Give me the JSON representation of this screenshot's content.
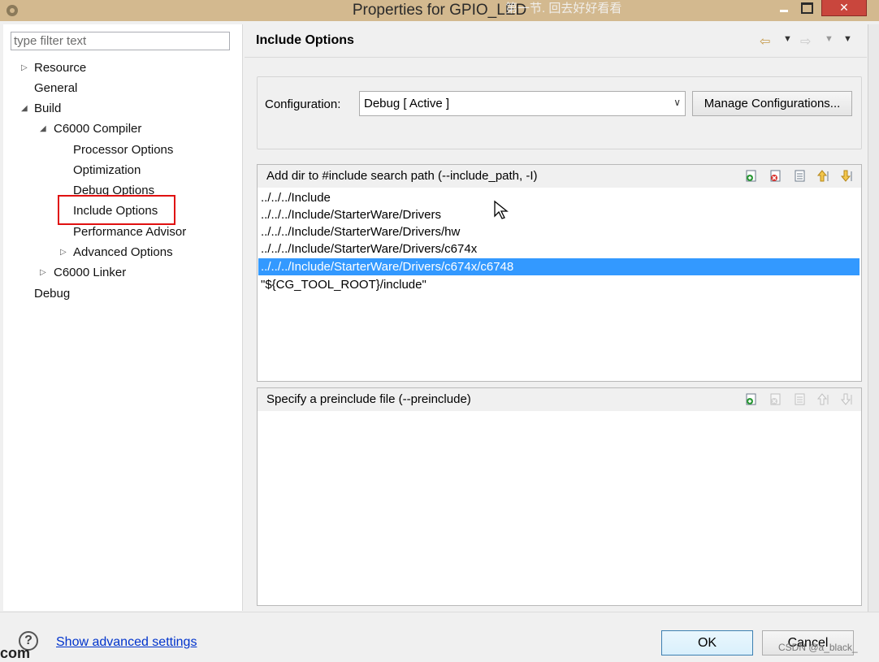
{
  "window": {
    "title": "Properties for GPIO_LED",
    "title_overlay": "第一节. 回去好好看看",
    "min_icon": "minimize-icon",
    "max_icon": "maximize-icon",
    "close_label": "✕"
  },
  "filter": {
    "placeholder": "type filter text",
    "value": ""
  },
  "tree": {
    "items": [
      {
        "label": "Resource"
      },
      {
        "label": "General"
      },
      {
        "label": "Build"
      },
      {
        "label": "C6000 Compiler"
      },
      {
        "label": "Processor Options"
      },
      {
        "label": "Optimization"
      },
      {
        "label": "Debug Options"
      },
      {
        "label": "Include Options",
        "selected": true
      },
      {
        "label": "Performance Advisor"
      },
      {
        "label": "Advanced Options"
      },
      {
        "label": "C6000 Linker"
      },
      {
        "label": "Debug"
      }
    ]
  },
  "header": {
    "title": "Include Options"
  },
  "configuration": {
    "label": "Configuration:",
    "value": "Debug  [ Active ]",
    "manage_label": "Manage Configurations..."
  },
  "include_paths": {
    "label": "Add dir to #include search path (--include_path, -I)",
    "rows": [
      "../../../Include",
      "../../../Include/StarterWare/Drivers",
      "../../../Include/StarterWare/Drivers/hw",
      "../../../Include/StarterWare/Drivers/c674x",
      "../../../Include/StarterWare/Drivers/c674x/c6748",
      "\"${CG_TOOL_ROOT}/include\""
    ],
    "selected_index": 4
  },
  "preinclude": {
    "label": "Specify a preinclude file (--preinclude)",
    "rows": []
  },
  "tools": [
    "add-icon",
    "delete-icon",
    "edit-icon",
    "move-up-icon",
    "move-down-icon"
  ],
  "footer": {
    "help_glyph": "?",
    "advanced_link": "Show advanced settings",
    "ok_label": "OK",
    "cancel_label": "Cancel",
    "watermark": "CSDN @a_black_",
    "edge_text": "com"
  },
  "colors": {
    "titlebar": "#d3b98f",
    "selection": "#3399ff",
    "highlight_box": "#e01010",
    "link": "#0033cc"
  }
}
